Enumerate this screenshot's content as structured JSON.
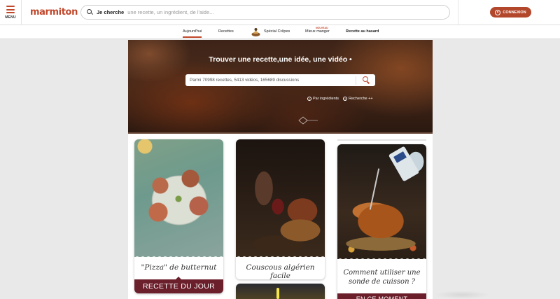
{
  "header": {
    "menu_label": "MENU",
    "logo": "marmiton",
    "search_strong": "Je cherche",
    "search_placeholder": "une recette, un ingrédient, de l'aide...",
    "connexion": "CONNEXION"
  },
  "subnav": {
    "items": [
      {
        "label": "Aujourd'hui",
        "active": true
      },
      {
        "label": "Recettes"
      },
      {
        "label": "Spécial Crêpes"
      },
      {
        "label": "Mieux manger",
        "badge": "NOUVEAU"
      },
      {
        "label": "Recette au hasard",
        "bold": true
      }
    ]
  },
  "hero": {
    "title": "Trouver une recette,une idée, une vidéo •",
    "search_placeholder": "Parmi 70998 recettes, 5413 vidéos, 165689 discussions",
    "link_ingredients": "Par ingrédients",
    "link_advanced": "Recherche ++"
  },
  "cards": [
    {
      "title": "\"Pizza\" de butternut",
      "banner": "RECETTE DU JOUR"
    },
    {
      "title": "Couscous algérien facile"
    },
    {
      "title": "Comment utiliser une sonde de cuisson ?",
      "banner": "EN CE MOMENT"
    }
  ],
  "colors": {
    "brand": "#c1472b",
    "connexion_bg": "#b3472c",
    "banner_bg": "#6a1f2b"
  },
  "icons": [
    "menu-icon",
    "search-icon",
    "user-icon",
    "crepe-icon",
    "help-circle-icon",
    "magnifier-icon"
  ]
}
